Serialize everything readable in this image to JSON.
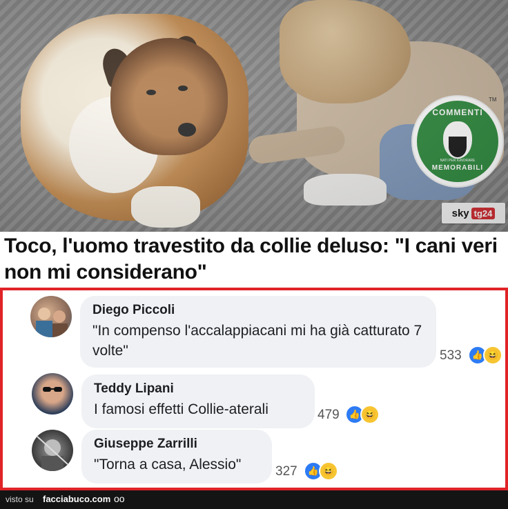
{
  "photo": {
    "logo": {
      "top_text": "COMMENTI",
      "bottom_text": "MEMORABILI",
      "small_text": "NATI PER IGNORARE",
      "tm": "TM"
    },
    "badge": {
      "sky": "sky",
      "tg": "tg24"
    }
  },
  "headline": "Toco, l'uomo travestito da collie deluso: \"I cani veri non mi considerano\"",
  "comments": [
    {
      "author": "Diego Piccoli",
      "text": "\"In compenso l'accalappiacani mi ha già catturato 7 volte\"",
      "reactions": "533"
    },
    {
      "author": "Teddy Lipani",
      "text": "I famosi effetti Collie-aterali",
      "reactions": "479"
    },
    {
      "author": "Giuseppe Zarrilli",
      "text": "\"Torna a casa, Alessio\"",
      "reactions": "327"
    }
  ],
  "footer": {
    "prefix": "visto su",
    "site": "facciabuco.com",
    "mascot": "oo"
  },
  "colors": {
    "border": "#e02327",
    "like": "#2d7bf4",
    "haha": "#f7c532",
    "bubble": "#eff1f4"
  }
}
